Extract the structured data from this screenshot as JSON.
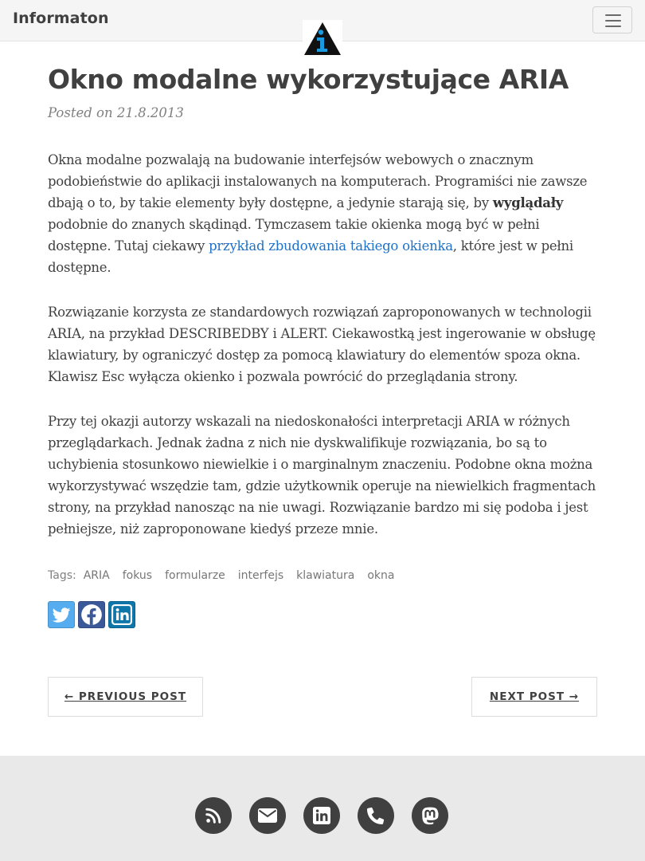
{
  "navbar": {
    "brand": "Informaton",
    "menu_toggle_icon": "hamburger-menu-icon",
    "logo_icon": "info-triangle-logo"
  },
  "post": {
    "title": "Okno modalne wykorzystujące ARIA",
    "meta": "Posted on 21.8.2013",
    "p1": {
      "t1": "Okna modalne pozwalają na budowanie interfejsów webowych o znacznym podobieństwie do aplikacji instalowanych na komputerach. Programiści nie zawsze dbają o to, by takie elementy były dostępne, a jedynie starają się, by ",
      "bold": "wyglądały",
      "t2": " podobnie do znanych skądinąd. Tymczasem takie okienka mogą być w pełni dostępne. Tutaj ciekawy ",
      "link": "przykład zbudowania takiego okienka",
      "t3": ", które jest w pełni dostępne."
    },
    "p2": "Rozwiązanie korzysta ze standardowych rozwiązań zaproponowanych w technologii ARIA, na przykład DESCRIBEDBY i ALERT. Ciekawostką jest ingerowanie w obsługę klawiatury, by ograniczyć dostęp za pomocą klawiatury do elementów spoza okna. Klawisz Esc wyłącza okienko i pozwala powrócić do przeglądania strony.",
    "p3": "Przy tej okazji autorzy wskazali na niedoskonałości interpretacji ARIA w różnych przeglądarkach. Jednak żadna z nich nie dyskwalifikuje rozwiązania, bo są to uchybienia stosunkowo niewielkie i o marginalnym znaczeniu. Podobne okna można wykorzystywać wszędzie tam, gdzie użytkownik operuje na niewielkich fragmentach strony, na przykład nanosząc na nie uwagi. Rozwiązanie bardzo mi się podoba i jest pełniejsze, niż zaproponowane kiedyś przeze mnie.",
    "tags_label": "Tags:",
    "tags": [
      "ARIA",
      "fokus",
      "formularze",
      "interfejs",
      "klawiatura",
      "okna"
    ]
  },
  "share": {
    "icons": [
      "twitter-icon",
      "facebook-icon",
      "linkedin-icon"
    ],
    "colors": {
      "twitter": "#55acee",
      "facebook": "#3b5998",
      "linkedin": "#0e76a8"
    }
  },
  "pager": {
    "prev": "← PREVIOUS POST",
    "next": "NEXT POST →"
  },
  "footer": {
    "icons": [
      "rss-icon",
      "envelope-icon",
      "linkedin-icon",
      "phone-icon",
      "mastodon-icon"
    ]
  },
  "colors": {
    "link": "#1f72c8",
    "text": "#404040",
    "footer_bg": "#e9e9e9",
    "logo_accent": "#1a9be0"
  }
}
